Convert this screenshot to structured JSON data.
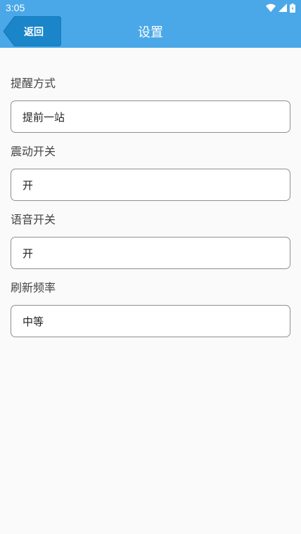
{
  "status_bar": {
    "time": "3:05",
    "icons": [
      "wifi-icon",
      "signal-icon",
      "battery-icon"
    ]
  },
  "header": {
    "back_label": "返回",
    "title": "设置",
    "color": "#4aa8e8"
  },
  "settings": [
    {
      "label": "提醒方式",
      "value": "提前一站"
    },
    {
      "label": "震动开关",
      "value": "开"
    },
    {
      "label": "语音开关",
      "value": "开"
    },
    {
      "label": "刷新频率",
      "value": "中等"
    }
  ]
}
